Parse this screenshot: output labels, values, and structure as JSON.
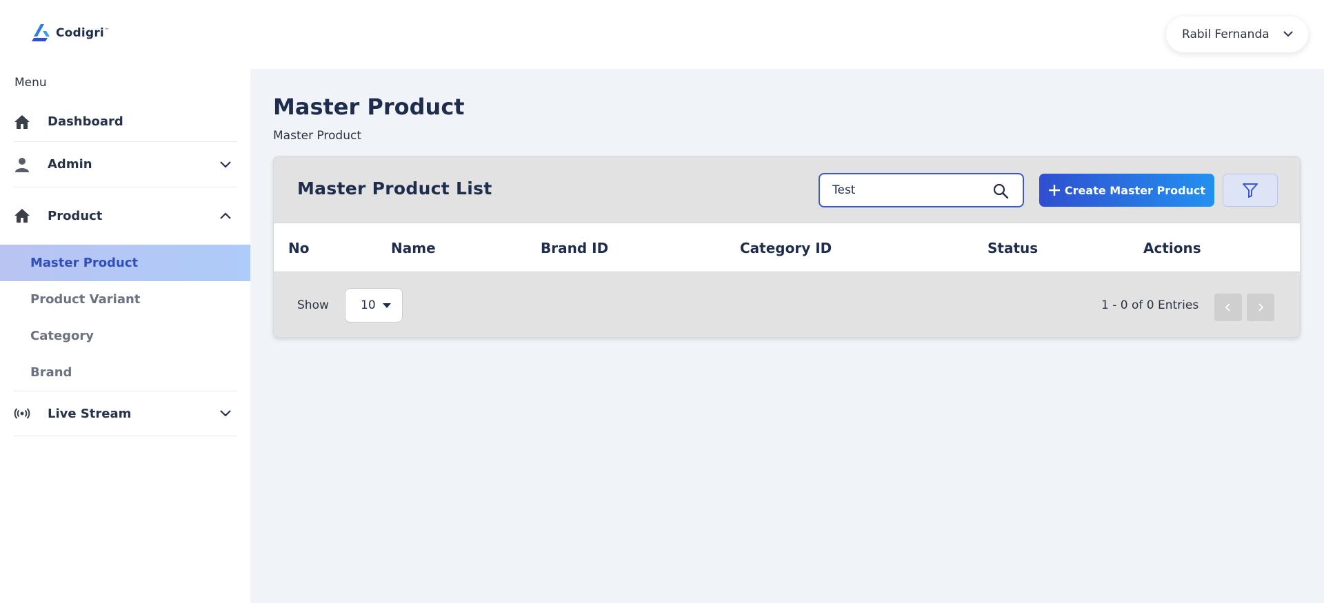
{
  "app": {
    "logo_text": "Codigri",
    "logo_tm": "™"
  },
  "sidebar": {
    "menu_caption": "Menu",
    "items": [
      {
        "label": "Dashboard",
        "icon": "home-icon"
      },
      {
        "label": "Admin",
        "icon": "user-icon",
        "expanded": false
      },
      {
        "label": "Product",
        "icon": "home-icon",
        "expanded": true
      },
      {
        "label": "Live Stream",
        "icon": "broadcast-icon",
        "expanded": false
      }
    ],
    "product_sub_items": [
      {
        "label": "Master Product",
        "active": true
      },
      {
        "label": "Product Variant",
        "active": false
      },
      {
        "label": "Category",
        "active": false
      },
      {
        "label": "Brand",
        "active": false
      }
    ]
  },
  "header": {
    "user_name": "Rabil Fernanda"
  },
  "main": {
    "page_title": "Master Product",
    "breadcrumb": "Master Product",
    "card": {
      "title": "Master Product List",
      "search_value": "Test",
      "create_button_label": "Create Master Product",
      "columns": [
        "No",
        "Name",
        "Brand ID",
        "Category ID",
        "Status",
        "Actions"
      ],
      "rows": [],
      "show_label": "Show",
      "page_size": "10",
      "entries_text": "1 - 0 of 0 Entries"
    }
  },
  "colors": {
    "accent": "#2f4fd0",
    "accent_end": "#2391f0",
    "active_nav_bg": "#b9c4f2",
    "active_nav_text": "#2f4ec0",
    "page_bg": "#f0f4f9"
  }
}
